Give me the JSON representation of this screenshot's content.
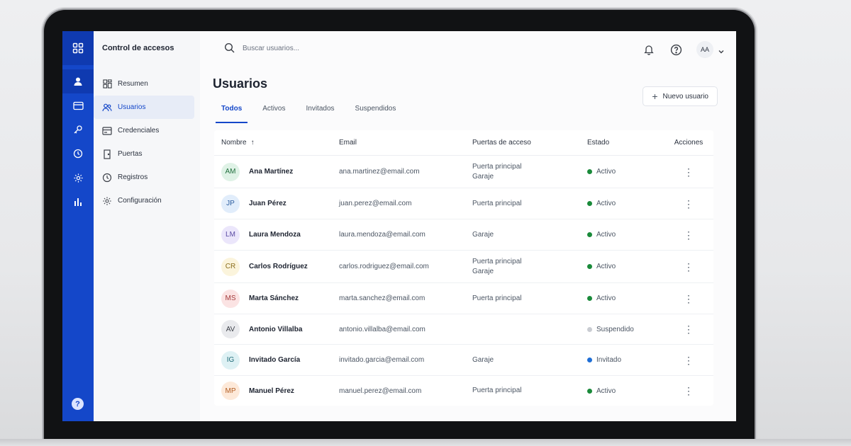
{
  "app": {
    "title": "Control de accesos"
  },
  "nav": {
    "items": [
      {
        "label": "Resumen",
        "icon": "dashboard-icon",
        "active": false
      },
      {
        "label": "Usuarios",
        "icon": "users-icon",
        "active": true
      },
      {
        "label": "Credenciales",
        "icon": "credential-card-icon",
        "active": false
      },
      {
        "label": "Puertas",
        "icon": "door-icon",
        "active": false
      },
      {
        "label": "Registros",
        "icon": "clock-icon",
        "active": false
      },
      {
        "label": "Configuración",
        "icon": "gear-icon",
        "active": false
      }
    ]
  },
  "rail": {
    "icons": [
      "apps-grid-icon",
      "user-icon",
      "card-icon",
      "key-icon",
      "clock-icon",
      "gear-icon",
      "bar-chart-icon",
      "help-icon"
    ],
    "help_label": "?"
  },
  "search": {
    "placeholder": "Buscar usuarios..."
  },
  "topbar": {
    "avatar_initials": "AA"
  },
  "page": {
    "title": "Usuarios",
    "new_user_label": "Nuevo usuario"
  },
  "tabs": [
    {
      "label": "Todos",
      "active": true
    },
    {
      "label": "Activos",
      "active": false
    },
    {
      "label": "Invitados",
      "active": false
    },
    {
      "label": "Suspendidos",
      "active": false
    }
  ],
  "table": {
    "headers": {
      "name": "Nombre",
      "email": "Email",
      "doors": "Puertas de acceso",
      "status": "Estado",
      "actions": "Acciones"
    },
    "rows": [
      {
        "initials": "AM",
        "name": "Ana Martínez",
        "email": "ana.martinez@email.com",
        "doors": [
          "Puerta principal",
          "Garaje"
        ],
        "status": "Activo",
        "status_color": "#1a8a3a",
        "avatar_bg": "#dff2e6",
        "avatar_fg": "#1f6e3c"
      },
      {
        "initials": "JP",
        "name": "Juan Pérez",
        "email": "juan.perez@email.com",
        "doors": [
          "Puerta principal"
        ],
        "status": "Activo",
        "status_color": "#1a8a3a",
        "avatar_bg": "#e1edfb",
        "avatar_fg": "#2b5c9e"
      },
      {
        "initials": "LM",
        "name": "Laura Mendoza",
        "email": "laura.mendoza@email.com",
        "doors": [
          "Garaje"
        ],
        "status": "Activo",
        "status_color": "#1a8a3a",
        "avatar_bg": "#ebe6fb",
        "avatar_fg": "#5a4aa3"
      },
      {
        "initials": "CR",
        "name": "Carlos Rodríguez",
        "email": "carlos.rodriguez@email.com",
        "doors": [
          "Puerta principal",
          "Garaje"
        ],
        "status": "Activo",
        "status_color": "#1a8a3a",
        "avatar_bg": "#fbf4dc",
        "avatar_fg": "#8a6d1c"
      },
      {
        "initials": "MS",
        "name": "Marta Sánchez",
        "email": "marta.sanchez@email.com",
        "doors": [
          "Puerta principal"
        ],
        "status": "Activo",
        "status_color": "#1a8a3a",
        "avatar_bg": "#fbe3e3",
        "avatar_fg": "#a33b3b"
      },
      {
        "initials": "AV",
        "name": "Antonio Villalba",
        "email": "antonio.villalba@email.com",
        "doors": [],
        "status": "Suspendido",
        "status_color": "#c9ccd2",
        "avatar_bg": "#e9eaed",
        "avatar_fg": "#3b3f47"
      },
      {
        "initials": "IG",
        "name": "Invitado García",
        "email": "invitado.garcia@email.com",
        "doors": [
          "Garaje"
        ],
        "status": "Invitado",
        "status_color": "#1f6fd6",
        "avatar_bg": "#def1f4",
        "avatar_fg": "#1f6b78"
      },
      {
        "initials": "MP",
        "name": "Manuel Pérez",
        "email": "manuel.perez@email.com",
        "doors": [
          "Puerta principal"
        ],
        "status": "Activo",
        "status_color": "#1a8a3a",
        "avatar_bg": "#fde9d9",
        "avatar_fg": "#b25c21"
      }
    ]
  },
  "colors": {
    "accent": "#1447c9"
  }
}
